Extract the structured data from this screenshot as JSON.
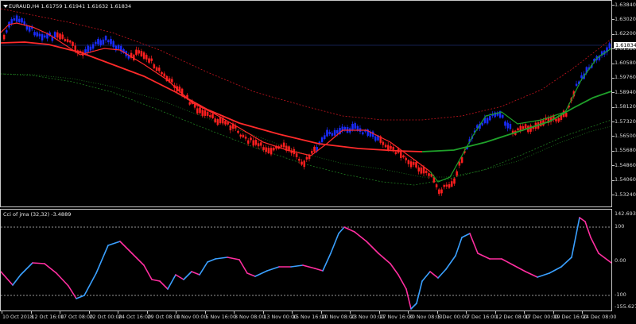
{
  "main_chart": {
    "symbol_info": "EURAUD,H4  1.61759 1.61941 1.61632 1.61834",
    "price_labels": [
      "1.63840",
      "1.63020",
      "1.62200",
      "1.61380",
      "1.60580",
      "1.59760",
      "1.58940",
      "1.58120",
      "1.57320",
      "1.56500",
      "1.55680",
      "1.54860",
      "1.54060",
      "1.53240"
    ],
    "current_price": "1.61834",
    "colors": {
      "bull": "#1a2cff",
      "bear": "#ff1f1f",
      "band": "#c8141e",
      "ma_red": "#ff2a2a",
      "ma_green": "#1fa12a",
      "low_band": "#1f7a1f"
    }
  },
  "indicator": {
    "title": "Cci of jma (32,32) -3.4889",
    "level_labels": [
      "142.6934",
      "100",
      "0.00",
      "-100",
      "-155.6275"
    ],
    "colors": {
      "up": "#3aa0ff",
      "down": "#ff2ea0",
      "levels": "#c8c8c8"
    }
  },
  "time_axis": {
    "labels": [
      "10 Oct 2018",
      "12 Oct 16:00",
      "17 Oct 08:00",
      "22 Oct 00:00",
      "24 Oct 16:00",
      "29 Oct 08:00",
      "1 Nov 00:00",
      "5 Nov 16:00",
      "8 Nov 08:00",
      "13 Nov 00:00",
      "15 Nov 16:00",
      "20 Nov 08:00",
      "23 Nov 00:00",
      "27 Nov 16:00",
      "30 Nov 08:00",
      "5 Dec 00:00",
      "7 Dec 16:00",
      "12 Dec 08:00",
      "17 Dec 00:00",
      "19 Dec 16:00",
      "24 Dec 08:00"
    ]
  }
}
